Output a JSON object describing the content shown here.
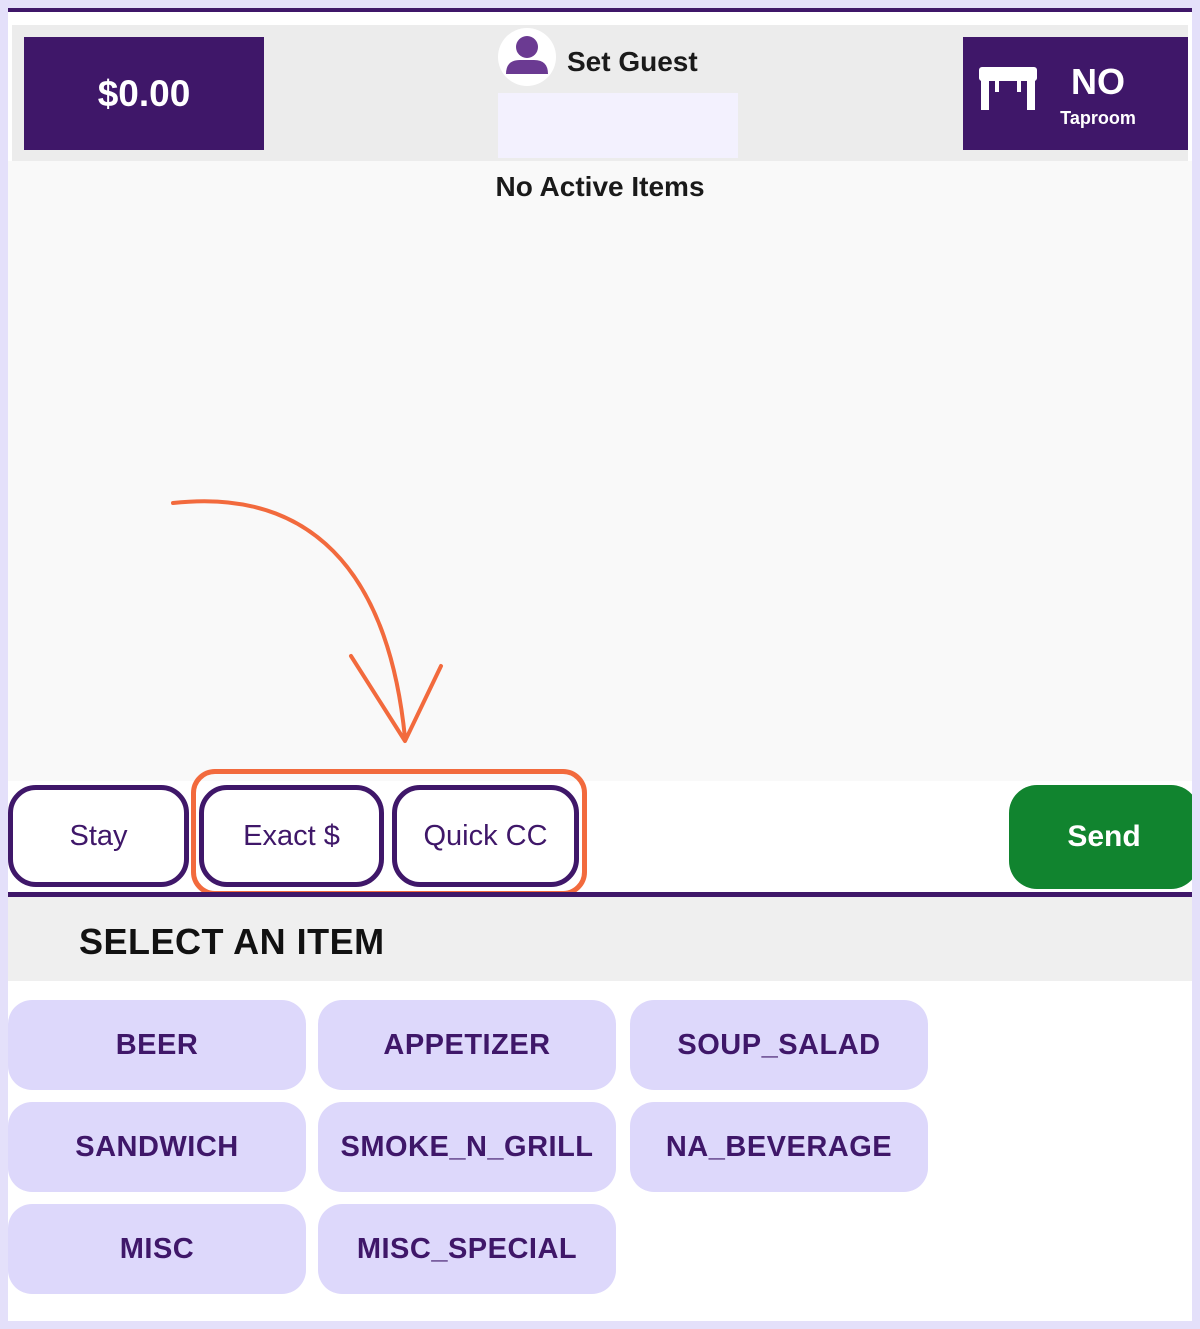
{
  "header": {
    "total": "$0.00",
    "guest_label": "Set Guest",
    "guest_value": "",
    "table_number": "NO",
    "table_room": "Taproom"
  },
  "items": {
    "empty_message": "No Active Items"
  },
  "actions": {
    "stay": "Stay",
    "exact": "Exact $",
    "quick_cc": "Quick CC",
    "send": "Send"
  },
  "menu": {
    "title": "SELECT AN ITEM",
    "categories": [
      "BEER",
      "APPETIZER",
      "SOUP_SALAD",
      "SANDWICH",
      "SMOKE_N_GRILL",
      "NA_BEVERAGE",
      "MISC",
      "MISC_SPECIAL"
    ]
  },
  "colors": {
    "brand_purple": "#3f1769",
    "send_green": "#11842f",
    "category_bg": "#ddd8fb",
    "annotation_orange": "#f26a3d"
  },
  "icons": {
    "guest": "person-icon",
    "table": "table-icon"
  }
}
